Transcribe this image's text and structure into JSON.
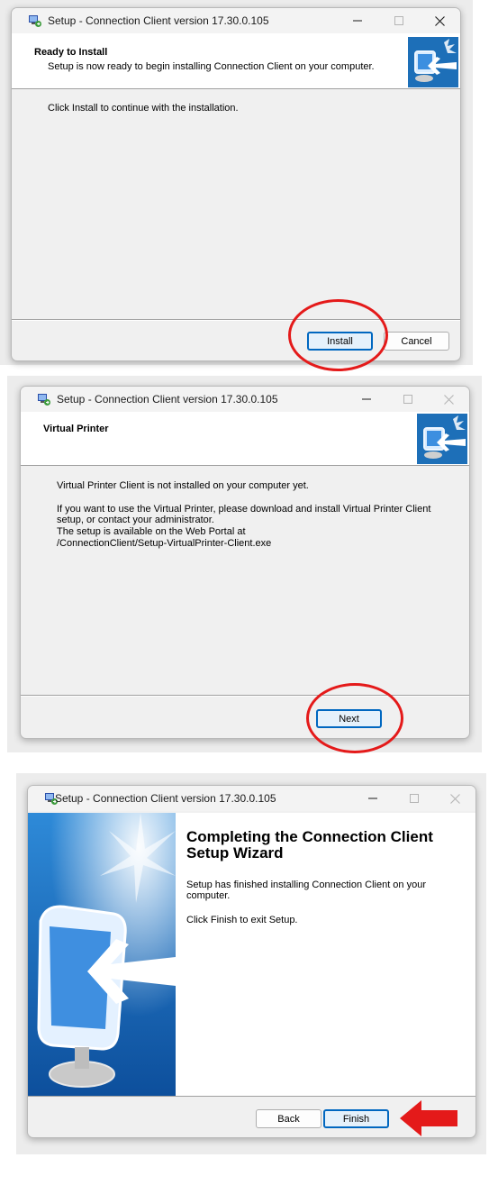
{
  "window1": {
    "title": "Setup - Connection Client version 17.30.0.105",
    "header_title": "Ready to Install",
    "header_subtitle": "Setup is now ready to begin installing Connection Client on your computer.",
    "body_text": "Click Install to continue with the installation.",
    "install_label": "Install",
    "cancel_label": "Cancel"
  },
  "window2": {
    "title": "Setup - Connection Client version 17.30.0.105",
    "header_title": "Virtual Printer",
    "line1": "Virtual Printer Client is not installed on your computer yet.",
    "line2": "If you want to use the Virtual Printer, please download and install Virtual Printer Client",
    "line3": "setup, or contact your administrator.",
    "line4": "The setup is available on the Web Portal at",
    "line5": "/ConnectionClient/Setup-VirtualPrinter-Client.exe",
    "next_label": "Next"
  },
  "window3": {
    "title": "Setup - Connection Client version 17.30.0.105",
    "heading_line1": "Completing the Connection Client",
    "heading_line2": "Setup Wizard",
    "text1_line1": "Setup has finished installing Connection Client on your",
    "text1_line2": "computer.",
    "text2": "Click Finish to exit Setup.",
    "back_label": "Back",
    "finish_label": "Finish"
  },
  "colors": {
    "annotation_red": "#e41a1a",
    "focus_blue": "#0067c0"
  },
  "icons": [
    "setup-app-icon",
    "minimize-icon",
    "maximize-icon",
    "close-icon",
    "monitor-arrow-icon",
    "red-arrow-icon"
  ]
}
